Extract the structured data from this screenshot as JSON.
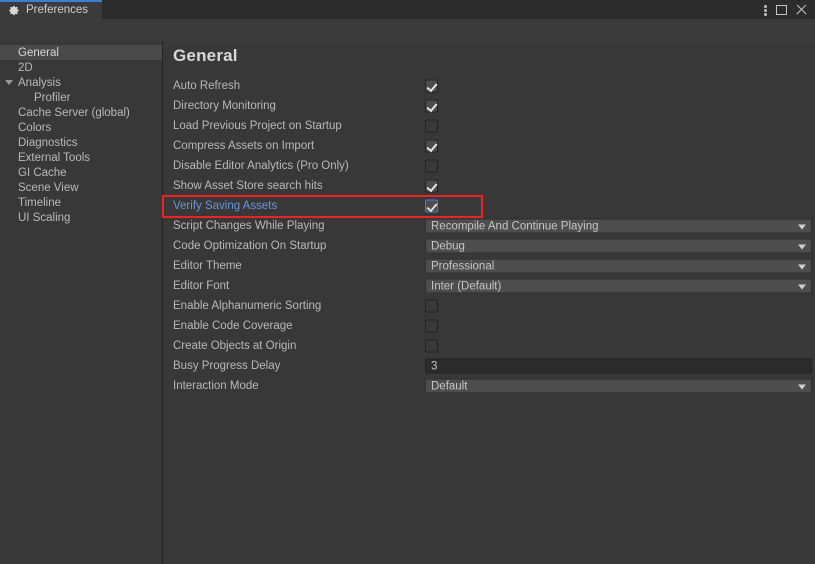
{
  "window": {
    "tab_label": "Preferences",
    "tab_icon": "gear-icon",
    "menu_icon": "kebab-menu-icon",
    "maximize_icon": "maximize-icon",
    "close_icon": "close-icon",
    "accent_color": "#3b7fd4"
  },
  "search": {
    "value": "",
    "placeholder": "",
    "icon": "search-icon"
  },
  "sidebar": {
    "items": [
      {
        "label": "General",
        "selected": true,
        "child": false,
        "expander": false
      },
      {
        "label": "2D",
        "selected": false,
        "child": false,
        "expander": false
      },
      {
        "label": "Analysis",
        "selected": false,
        "child": false,
        "expander": true
      },
      {
        "label": "Profiler",
        "selected": false,
        "child": true,
        "expander": false
      },
      {
        "label": "Cache Server (global)",
        "selected": false,
        "child": false,
        "expander": false
      },
      {
        "label": "Colors",
        "selected": false,
        "child": false,
        "expander": false
      },
      {
        "label": "Diagnostics",
        "selected": false,
        "child": false,
        "expander": false
      },
      {
        "label": "External Tools",
        "selected": false,
        "child": false,
        "expander": false
      },
      {
        "label": "GI Cache",
        "selected": false,
        "child": false,
        "expander": false
      },
      {
        "label": "Scene View",
        "selected": false,
        "child": false,
        "expander": false
      },
      {
        "label": "Timeline",
        "selected": false,
        "child": false,
        "expander": false
      },
      {
        "label": "UI Scaling",
        "selected": false,
        "child": false,
        "expander": false
      }
    ]
  },
  "main": {
    "title": "General",
    "highlight_color": "#ee2222",
    "rows": [
      {
        "label": "Auto Refresh",
        "type": "checkbox",
        "checked": true,
        "highlighted": false
      },
      {
        "label": "Directory Monitoring",
        "type": "checkbox",
        "checked": true,
        "highlighted": false
      },
      {
        "label": "Load Previous Project on Startup",
        "type": "checkbox",
        "checked": false,
        "highlighted": false
      },
      {
        "label": "Compress Assets on Import",
        "type": "checkbox",
        "checked": true,
        "highlighted": false
      },
      {
        "label": "Disable Editor Analytics (Pro Only)",
        "type": "checkbox",
        "checked": false,
        "highlighted": false
      },
      {
        "label": "Show Asset Store search hits",
        "type": "checkbox",
        "checked": true,
        "highlighted": false
      },
      {
        "label": "Verify Saving Assets",
        "type": "checkbox",
        "checked": true,
        "highlighted": true
      },
      {
        "label": "Script Changes While Playing",
        "type": "dropdown",
        "value": "Recompile And Continue Playing",
        "highlighted": false
      },
      {
        "label": "Code Optimization On Startup",
        "type": "dropdown",
        "value": "Debug",
        "highlighted": false
      },
      {
        "label": "Editor Theme",
        "type": "dropdown",
        "value": "Professional",
        "highlighted": false
      },
      {
        "label": "Editor Font",
        "type": "dropdown",
        "value": "Inter (Default)",
        "highlighted": false
      },
      {
        "label": "Enable Alphanumeric Sorting",
        "type": "checkbox",
        "checked": false,
        "highlighted": false
      },
      {
        "label": "Enable Code Coverage",
        "type": "checkbox",
        "checked": false,
        "highlighted": false
      },
      {
        "label": "Create Objects at Origin",
        "type": "checkbox",
        "checked": false,
        "highlighted": false
      },
      {
        "label": "Busy Progress Delay",
        "type": "textfield",
        "value": "3",
        "highlighted": false
      },
      {
        "label": "Interaction Mode",
        "type": "dropdown",
        "value": "Default",
        "highlighted": false
      }
    ]
  }
}
